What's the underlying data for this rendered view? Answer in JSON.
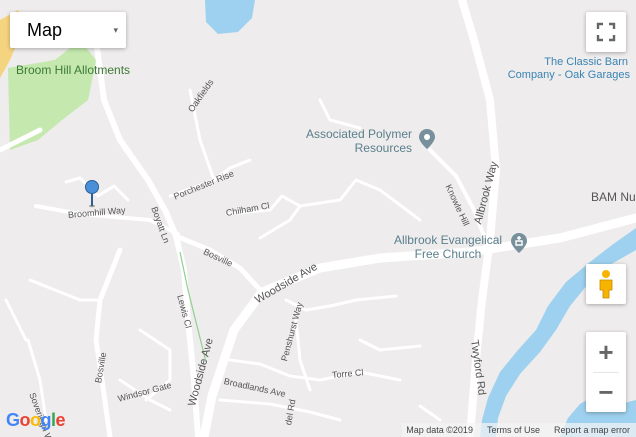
{
  "map_type": {
    "label": "Map",
    "chevron": "▾"
  },
  "colors": {
    "land": "#eeecec",
    "road": "#ffffff",
    "water": "#9ed1ef",
    "park": "#c4e8ad",
    "poi": "#5a7f8c",
    "marker": "#4a90d9"
  },
  "places": {
    "broom_hill": "Broom Hill Allotments",
    "associated": "Associated Polymer Resources",
    "allbrook_church": "Allbrook Evangelical Free Church",
    "classic_barn": "The Classic Barn",
    "classic_barn_2": "Company - Oak Garages",
    "bam": "BAM Nu"
  },
  "roads": {
    "oakfields": "Oakfields",
    "porchester": "Porchester Rise",
    "chilham": "Chilham Cl",
    "broomhill": "Broomhill Way",
    "boyatt": "Boyatt Ln",
    "bosville": "Bosville",
    "woodside": "Woodside Ave",
    "woodside2": "Woodside Ave",
    "lewis": "Lewis Cl",
    "penshurst": "Penshurst Way",
    "broadlands": "Broadlands Ave",
    "torre": "Torre Cl",
    "windsor": "Windsor Gate",
    "bosville2": "Bosville",
    "soveriegn": "Soveriegn Way",
    "knowle": "Knowle Hill",
    "allbrook_way": "Allbrook Way",
    "twyford": "Twyford Rd",
    "del": "del Rd"
  },
  "attribution": {
    "data": "Map data ©2019",
    "terms": "Terms of Use",
    "report": "Report a map error"
  },
  "logo": "Google",
  "controls": {
    "zoom_in": "+",
    "zoom_out": "−"
  }
}
